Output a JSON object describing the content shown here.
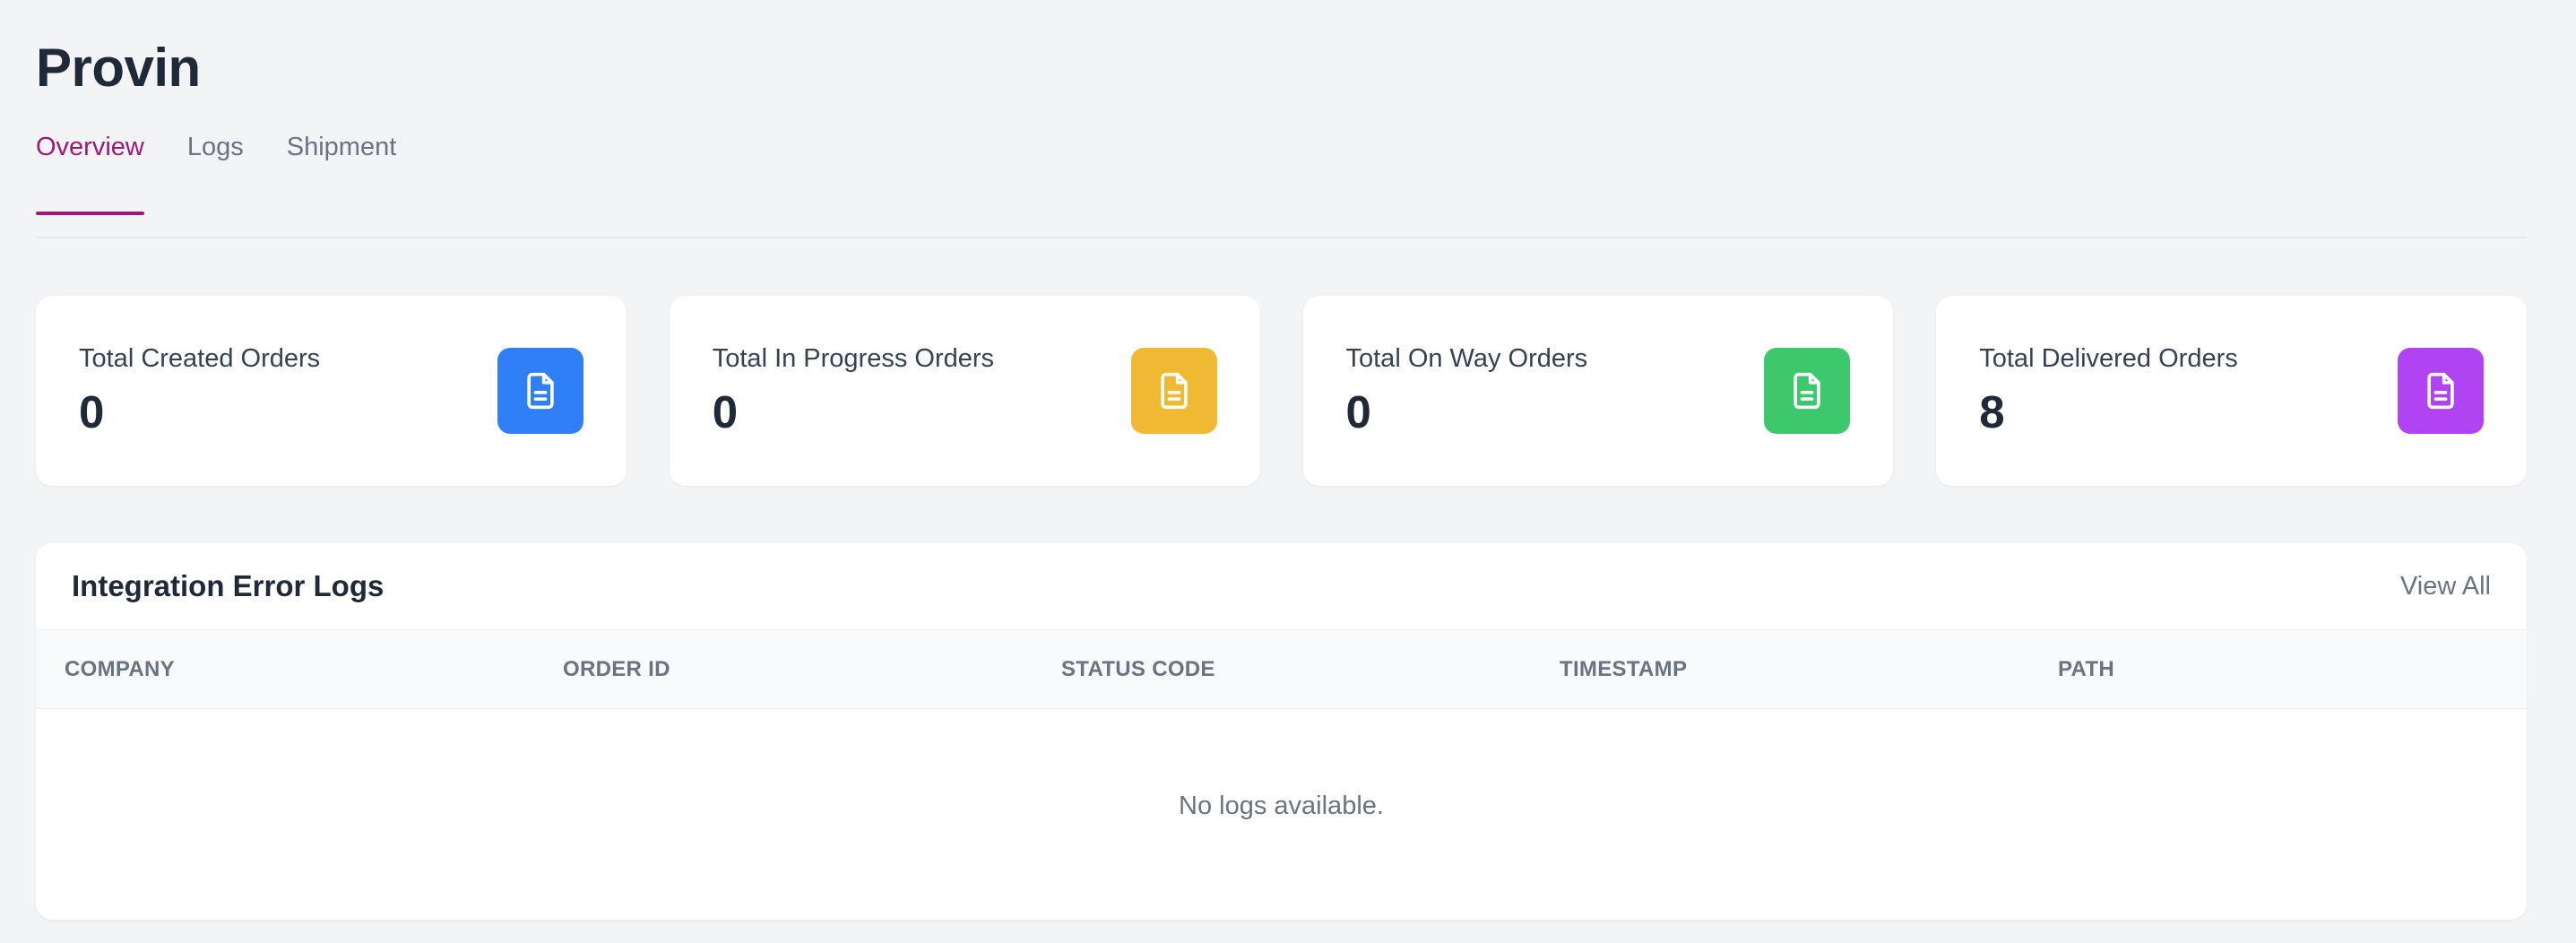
{
  "page": {
    "title": "Provin"
  },
  "tabs": [
    {
      "label": "Overview",
      "active": true
    },
    {
      "label": "Logs",
      "active": false
    },
    {
      "label": "Shipment",
      "active": false
    }
  ],
  "stats": [
    {
      "label": "Total Created Orders",
      "value": "0",
      "icon": "document-icon",
      "color": "#2f80f6"
    },
    {
      "label": "Total In Progress Orders",
      "value": "0",
      "icon": "document-icon",
      "color": "#efba32"
    },
    {
      "label": "Total On Way Orders",
      "value": "0",
      "icon": "document-icon",
      "color": "#3ec86e"
    },
    {
      "label": "Total Delivered Orders",
      "value": "8",
      "icon": "document-icon",
      "color": "#b044f2"
    }
  ],
  "logs": {
    "title": "Integration Error Logs",
    "view_all": "View All",
    "columns": [
      "COMPANY",
      "ORDER ID",
      "STATUS CODE",
      "TIMESTAMP",
      "PATH"
    ],
    "empty_message": "No logs available."
  },
  "colors": {
    "accent": "#9d1a77",
    "background": "#f3f4f6"
  }
}
